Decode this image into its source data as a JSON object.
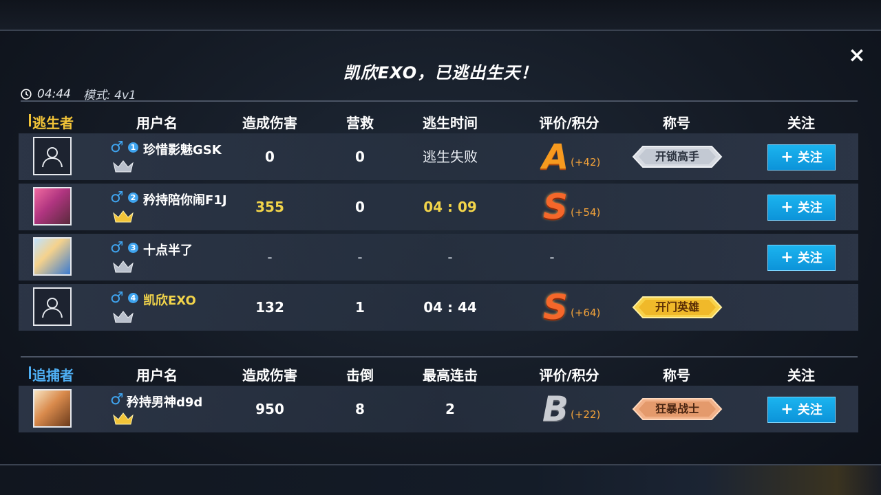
{
  "title": "凯欣EXO，已逃出生天！",
  "meta": {
    "time": "04:44",
    "mode": "模式: 4v1"
  },
  "close_icon": "×",
  "colors": {
    "escape": "#f2c438",
    "hunter": "#4fb0f5",
    "follow": "#0c93d9"
  },
  "escape_header": {
    "role": "逃生者",
    "username": "用户名",
    "damage": "造成伤害",
    "rescue": "营救",
    "time": "逃生时间",
    "grade": "评价/积分",
    "title": "称号",
    "follow": "关注"
  },
  "escapers": [
    {
      "index": "1",
      "gender": "♂",
      "name": "珍惜影魅GSK",
      "damage": "0",
      "rescue": "0",
      "time": "逃生失败",
      "grade": "A",
      "score": "(+42)",
      "badge": "开锁高手",
      "follow": "关注"
    },
    {
      "index": "2",
      "gender": "♂",
      "name": "矜持陪你闹F1J",
      "damage": "355",
      "rescue": "0",
      "time": "04 : 09",
      "grade": "S",
      "score": "(+54)",
      "badge": "",
      "follow": "关注"
    },
    {
      "index": "3",
      "gender": "♂",
      "name": "十点半了",
      "damage": "-",
      "rescue": "-",
      "time": "-",
      "grade": "-",
      "score": "",
      "badge": "",
      "follow": "关注"
    },
    {
      "index": "4",
      "gender": "♂",
      "name": "凯欣EXO",
      "damage": "132",
      "rescue": "1",
      "time": "04 : 44",
      "grade": "S",
      "score": "(+64)",
      "badge": "开门英雄",
      "follow": ""
    }
  ],
  "hunter_header": {
    "role": "追捕者",
    "username": "用户名",
    "damage": "造成伤害",
    "knockdowns": "击倒",
    "combo": "最高连击",
    "grade": "评价/积分",
    "title": "称号",
    "follow": "关注"
  },
  "hunters": [
    {
      "gender": "♂",
      "name": "矜持男神d9d",
      "damage": "950",
      "knockdowns": "8",
      "combo": "2",
      "grade": "B",
      "score": "(+22)",
      "badge": "狂暴战士",
      "follow": "关注"
    }
  ],
  "follow_plus": "+"
}
